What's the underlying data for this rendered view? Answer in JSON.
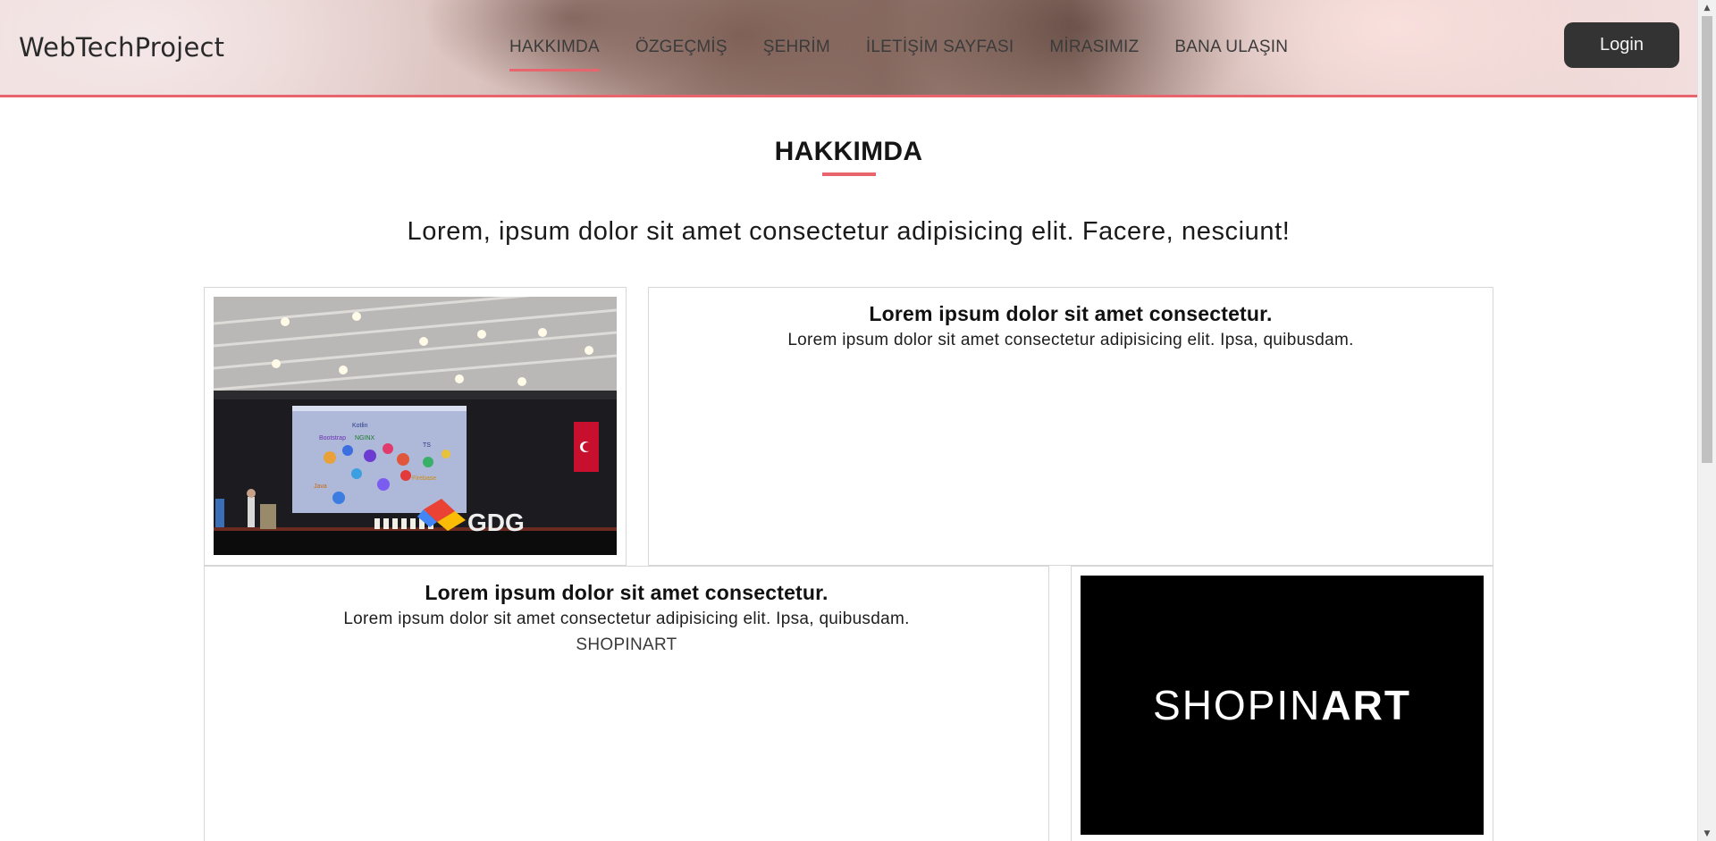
{
  "header": {
    "brand": "WebTechProject",
    "nav": [
      {
        "label": "HAKKIMDA",
        "active": true
      },
      {
        "label": "ÖZGEÇMİŞ",
        "active": false
      },
      {
        "label": "ŞEHRİM",
        "active": false
      },
      {
        "label": "İLETİŞİM SAYFASI",
        "active": false
      },
      {
        "label": "MİRASIMIZ",
        "active": false
      },
      {
        "label": "BANA ULAŞIN",
        "active": false
      }
    ],
    "login_label": "Login",
    "accent_color": "#e8656e"
  },
  "section": {
    "title": "HAKKIMDA",
    "lead": "Lorem, ipsum dolor sit amet consectetur adipisicing elit. Facere, nesciunt!"
  },
  "cards": {
    "first": {
      "heading": "Lorem ipsum dolor sit amet consectetur.",
      "text": "Lorem ipsum dolor sit amet consectetur adipisicing elit. Ipsa, quibusdam."
    },
    "second": {
      "heading": "Lorem ipsum dolor sit amet consectetur.",
      "text": "Lorem ipsum dolor sit amet consectetur adipisicing elit. Ipsa, quibusdam.",
      "extra": "SHOPINART"
    }
  },
  "images": {
    "conference_photo": {
      "icon": "conference-stage-photo",
      "screen_words": [
        "Kotlin",
        "NGINX",
        "TS",
        "Java",
        "Bootstrap",
        "Firebase"
      ],
      "logo_text": "GDG"
    },
    "shopinart_logo": {
      "light_part": "SHOPIN",
      "bold_part": "ART",
      "background": "#000000"
    }
  }
}
